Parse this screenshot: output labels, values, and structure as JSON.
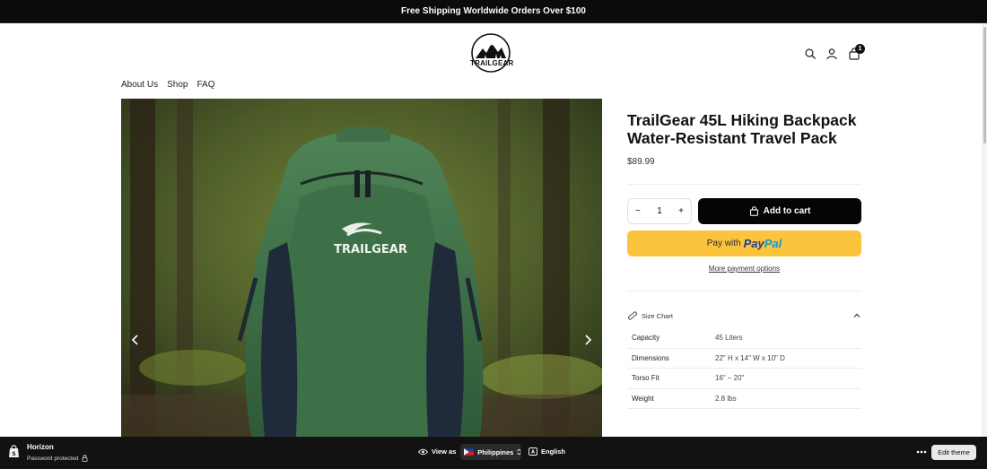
{
  "announcement": "Free Shipping Worldwide Orders Over $100",
  "logo": {
    "text": "TRAILGEAR"
  },
  "header": {
    "cart_count": "1"
  },
  "nav": {
    "items": [
      "About Us",
      "Shop",
      "FAQ"
    ]
  },
  "product": {
    "title_line1": "TrailGear 45L Hiking Backpack",
    "title_line2": "Water-Resistant Travel Pack",
    "price": "$89.99",
    "image_brand": "TRAILGEAR",
    "quantity": "1",
    "add_to_cart": "Add to cart",
    "paypal_prefix": "Pay with",
    "paypal_brand_a": "Pay",
    "paypal_brand_b": "Pal",
    "more_payment": "More payment options",
    "size_chart_label": "Size Chart",
    "specs": [
      {
        "label": "Capacity",
        "value": "45 Liters"
      },
      {
        "label": "Dimensions",
        "value": "22\" H x 14\" W x 10\" D"
      },
      {
        "label": "Torso Fit",
        "value": "16\" – 20\""
      },
      {
        "label": "Weight",
        "value": "2.8 lbs"
      }
    ]
  },
  "admin_bar": {
    "store_name": "Horizon",
    "status": "Password protected",
    "view_as": "View as",
    "country": "Philippines",
    "language": "English",
    "edit_theme": "Edit theme"
  },
  "icons": [
    "search-icon",
    "account-icon",
    "cart-icon",
    "minus-icon",
    "plus-icon",
    "cart-plus-icon",
    "ruler-icon",
    "chevron-up-icon",
    "chevron-left-icon",
    "chevron-right-icon",
    "shopify-bag-icon",
    "lock-icon",
    "eye-icon",
    "language-icon",
    "more-icon"
  ],
  "colors": {
    "primary": "#050505",
    "paypal": "#fcc33c",
    "admin_bar": "#121212"
  }
}
